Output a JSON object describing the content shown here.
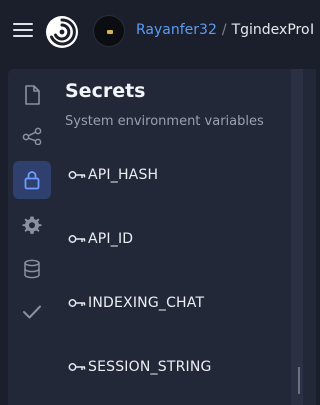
{
  "header": {
    "owner": "Rayanfer32",
    "separator": "/",
    "repo": "TgindexPro",
    "repo_overflow": "I"
  },
  "sidebar_icons": [
    {
      "name": "file-icon"
    },
    {
      "name": "share-icon"
    },
    {
      "name": "lock-icon",
      "active": true
    },
    {
      "name": "gear-icon"
    },
    {
      "name": "database-icon"
    },
    {
      "name": "check-icon"
    }
  ],
  "secrets_panel": {
    "title": "Secrets",
    "subtitle": "System environment variables",
    "items": [
      {
        "label": "API_HASH"
      },
      {
        "label": "API_ID"
      },
      {
        "label": "INDEXING_CHAT"
      },
      {
        "label": "SESSION_STRING"
      }
    ]
  },
  "colors": {
    "background": "#1b1f2b",
    "panel": "#232838",
    "accent_link": "#5a9cf3",
    "active_icon_bg": "#2f3f6e"
  }
}
